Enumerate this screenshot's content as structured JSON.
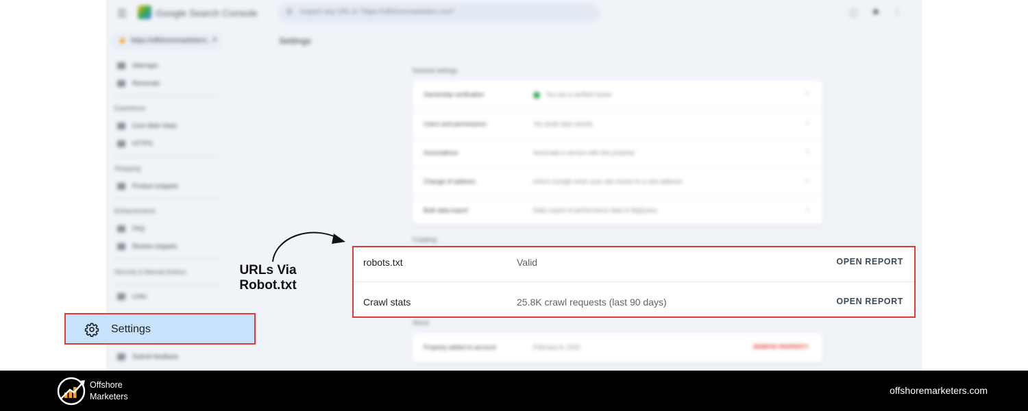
{
  "console": {
    "app_title": "Google Search Console",
    "search_placeholder": "Inspect any URL in \"https://offshoremarketers.com\"",
    "property": "https://offshoremarketers...",
    "page_title": "Settings",
    "sidebar": {
      "items_top": [
        "Sitemaps",
        "Removals"
      ],
      "experience_heading": "Experience",
      "experience_items": [
        "Core Web Vitals",
        "HTTPS"
      ],
      "shopping_heading": "Shopping",
      "shopping_items": [
        "Product snippets"
      ],
      "enhancements_heading": "Enhancements",
      "enhancements_items": [
        "FAQ",
        "Review snippets"
      ],
      "security_heading": "Security & Manual Actions",
      "bottom_items": [
        "Links",
        "Submit feedback"
      ]
    },
    "general_settings": {
      "heading": "General settings",
      "rows": [
        {
          "label": "Ownership verification",
          "value": "You are a verified owner"
        },
        {
          "label": "Users and permissions",
          "value": "Yes (bulk data saved)"
        },
        {
          "label": "Associations",
          "value": "Associate a service with this property"
        },
        {
          "label": "Change of address",
          "value": "Inform Google when your site moves to a new address"
        },
        {
          "label": "Bulk data export",
          "value": "Daily export of performance data to BigQuery"
        }
      ]
    },
    "crawling": {
      "heading": "Crawling",
      "rows": [
        {
          "name": "robots.txt",
          "value": "Valid",
          "action": "OPEN REPORT"
        },
        {
          "name": "Crawl stats",
          "value": "25.8K crawl requests (last 90 days)",
          "action": "OPEN REPORT"
        }
      ]
    },
    "about": {
      "heading": "About",
      "row_label": "Property added to account",
      "row_value": "February 8, 2022",
      "remove_action": "REMOVE PROPERTY"
    },
    "settings_nav_label": "Settings"
  },
  "annotation": {
    "line1": "URLs Via",
    "line2": "Robot.txt"
  },
  "footer": {
    "brand_line1": "Offshore",
    "brand_line2": "Marketers",
    "url": "offshoremarketers.com"
  },
  "colors": {
    "highlight_border": "#e53935",
    "settings_fill": "#c7e3fc",
    "footer_bg": "#000000",
    "brand_accent": "#f7a21b"
  }
}
